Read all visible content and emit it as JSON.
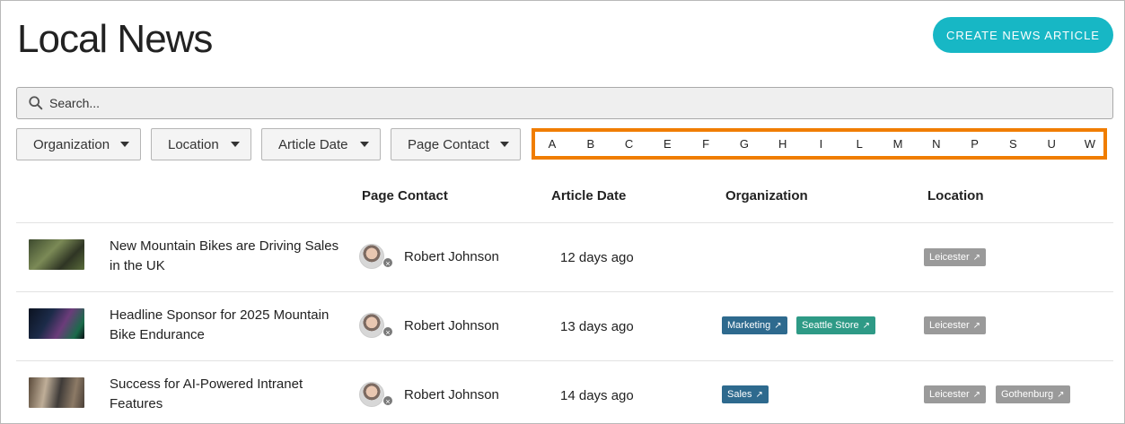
{
  "header": {
    "title": "Local News",
    "create_label": "CREATE NEWS ARTICLE"
  },
  "search": {
    "placeholder": "Search..."
  },
  "filters": [
    {
      "label": "Organization"
    },
    {
      "label": "Location"
    },
    {
      "label": "Article Date"
    },
    {
      "label": "Page Contact"
    }
  ],
  "alphabet": [
    "A",
    "B",
    "C",
    "E",
    "F",
    "G",
    "H",
    "I",
    "L",
    "M",
    "N",
    "P",
    "S",
    "U",
    "W"
  ],
  "columns": {
    "contact": "Page Contact",
    "date": "Article Date",
    "organization": "Organization",
    "location": "Location"
  },
  "rows": [
    {
      "title": "New Mountain Bikes are Driving Sales in the UK",
      "contact": "Robert Johnson",
      "date": "12 days ago",
      "organizations": [],
      "locations": [
        "Leicester"
      ]
    },
    {
      "title": "Headline Sponsor for 2025 Mountain Bike Endurance",
      "contact": "Robert Johnson",
      "date": "13 days ago",
      "organizations": [
        "Marketing",
        "Seattle Store"
      ],
      "locations": [
        "Leicester"
      ]
    },
    {
      "title": "Success for AI-Powered Intranet Features",
      "contact": "Robert Johnson",
      "date": "14 days ago",
      "organizations": [
        "Sales"
      ],
      "locations": [
        "Leicester",
        "Gothenburg"
      ]
    }
  ],
  "colors": {
    "accent": "#17b7c5",
    "alpha_border": "#f07d00",
    "tag_marketing": "#2e6a8e",
    "tag_seattle": "#2e9a86",
    "tag_sales": "#2e6a8e",
    "tag_location": "#9a9a9a"
  },
  "icons": {
    "search": "search-icon",
    "caret": "chevron-down-icon",
    "external": "external-link-icon"
  }
}
